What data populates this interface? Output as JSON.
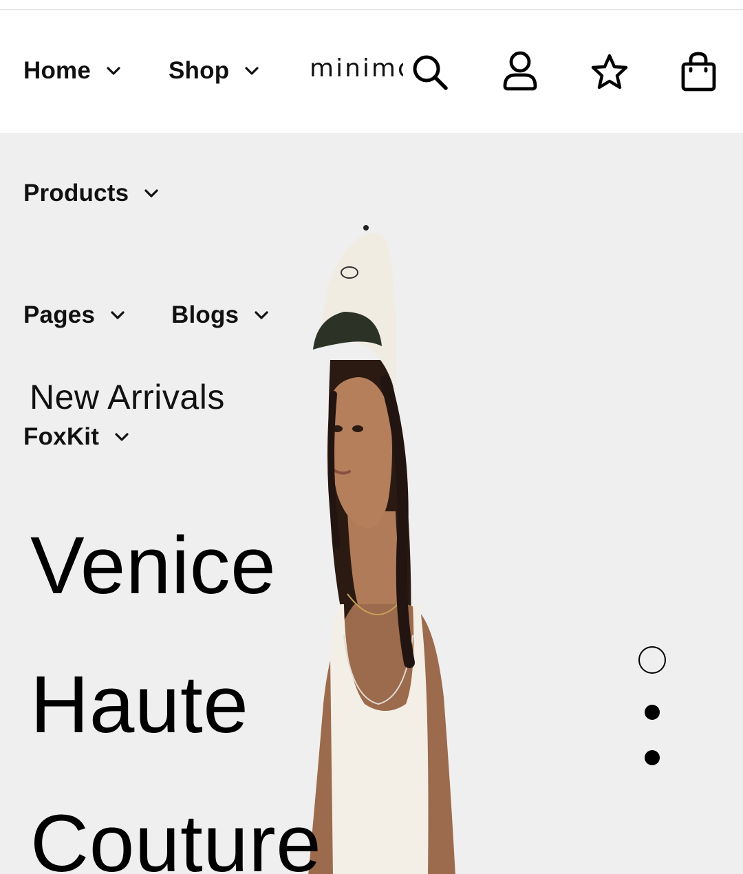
{
  "header": {
    "nav": [
      {
        "label": "Home"
      },
      {
        "label": "Shop"
      }
    ],
    "logo_text": "minimc",
    "icons": [
      "search-icon",
      "account-icon",
      "wishlist-star-icon",
      "cart-bag-icon"
    ]
  },
  "hero": {
    "nav": [
      {
        "label": "Products"
      },
      {
        "label": "Pages"
      },
      {
        "label": "Blogs"
      },
      {
        "label": "New Arrivals"
      },
      {
        "label": "FoxKit"
      }
    ],
    "headline": [
      "Venice",
      "Haute",
      "Couture"
    ],
    "slider": {
      "total": 3,
      "active_index": 0
    }
  },
  "colors": {
    "hero_background": "#efefef",
    "header_background": "#ffffff",
    "text": "#000000"
  }
}
